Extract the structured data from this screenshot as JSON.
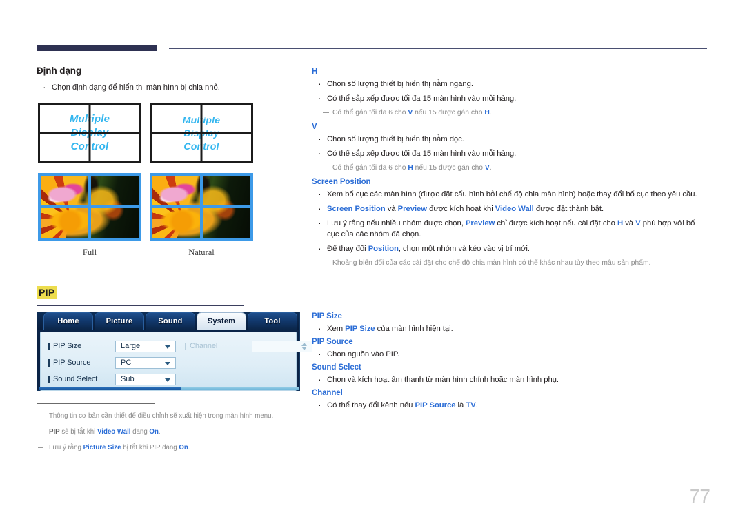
{
  "page": {
    "number": "77"
  },
  "left": {
    "section_title": "Định dạng",
    "bullet": "Chọn định dạng để hiển thị màn hình bị chia nhỏ.",
    "diagram": {
      "panel_a": {
        "text_lines": [
          "Multiple",
          "Display",
          "Control"
        ],
        "caption": "Full"
      },
      "panel_b": {
        "text_lines": [
          "Multiple",
          "Display",
          "Control"
        ],
        "caption": "Natural"
      }
    },
    "pip": {
      "label": "PIP"
    },
    "osd": {
      "tabs": [
        {
          "label": "Home",
          "active": false
        },
        {
          "label": "Picture",
          "active": false
        },
        {
          "label": "Sound",
          "active": false
        },
        {
          "label": "System",
          "active": true
        },
        {
          "label": "Tool",
          "active": false
        }
      ],
      "rows": [
        {
          "key": "PIP Size",
          "value": "Large"
        },
        {
          "key": "PIP Source",
          "value": "PC"
        },
        {
          "key": "Sound Select",
          "value": "Sub"
        }
      ],
      "channel": {
        "key": "Channel",
        "value": ""
      }
    },
    "footnotes": [
      {
        "parts": [
          {
            "t": "Thông tin cơ bản cần thiết để điều chỉnh sẽ xuất hiện trong màn hình menu.",
            "s": "plain"
          }
        ]
      },
      {
        "parts": [
          {
            "t": "PIP",
            "s": "dark"
          },
          {
            "t": " sẽ bị tắt khi ",
            "s": "plain"
          },
          {
            "t": "Video Wall",
            "s": "blue"
          },
          {
            "t": " đang ",
            "s": "plain"
          },
          {
            "t": "On",
            "s": "blue"
          },
          {
            "t": ".",
            "s": "plain"
          }
        ]
      },
      {
        "parts": [
          {
            "t": "Lưu ý rằng ",
            "s": "plain"
          },
          {
            "t": "Picture Size",
            "s": "blue"
          },
          {
            "t": " bị tắt khi PIP đang ",
            "s": "plain"
          },
          {
            "t": "On",
            "s": "blue"
          },
          {
            "t": ".",
            "s": "plain"
          }
        ]
      }
    ]
  },
  "right": {
    "blocks": [
      {
        "type": "head",
        "text": "H"
      },
      {
        "type": "bullet",
        "parts": [
          {
            "t": "Chọn số lượng thiết bị hiển thị nằm ngang.",
            "s": "plain"
          }
        ]
      },
      {
        "type": "bullet",
        "parts": [
          {
            "t": "Có thể sắp xếp được tối đa 15 màn hình vào mỗi hàng.",
            "s": "plain"
          }
        ]
      },
      {
        "type": "note",
        "parts": [
          {
            "t": "Có thể gán tối đa 6 cho ",
            "s": "plain"
          },
          {
            "t": "V",
            "s": "blue"
          },
          {
            "t": " nếu 15 được gán cho ",
            "s": "plain"
          },
          {
            "t": "H",
            "s": "blue"
          },
          {
            "t": ".",
            "s": "plain"
          }
        ]
      },
      {
        "type": "head",
        "text": "V"
      },
      {
        "type": "bullet",
        "parts": [
          {
            "t": "Chọn số lượng thiết bị hiển thị nằm dọc.",
            "s": "plain"
          }
        ]
      },
      {
        "type": "bullet",
        "parts": [
          {
            "t": "Có thể sắp xếp được tối đa 15 màn hình vào mỗi hàng.",
            "s": "plain"
          }
        ]
      },
      {
        "type": "note",
        "parts": [
          {
            "t": "Có thể gán tối đa 6 cho ",
            "s": "plain"
          },
          {
            "t": "H",
            "s": "blue"
          },
          {
            "t": " nếu 15 được gán cho ",
            "s": "plain"
          },
          {
            "t": "V",
            "s": "blue"
          },
          {
            "t": ".",
            "s": "plain"
          }
        ]
      },
      {
        "type": "head",
        "text": "Screen Position"
      },
      {
        "type": "bullet",
        "parts": [
          {
            "t": "Xem bố cục các màn hình (được đặt cấu hình bởi chế độ chia màn hình) hoặc thay đổi bố cục theo yêu cầu.",
            "s": "plain"
          }
        ]
      },
      {
        "type": "bullet",
        "parts": [
          {
            "t": "Screen Position",
            "s": "blue"
          },
          {
            "t": " và ",
            "s": "plain"
          },
          {
            "t": "Preview",
            "s": "blue"
          },
          {
            "t": " được kích hoạt khi ",
            "s": "plain"
          },
          {
            "t": "Video Wall",
            "s": "blue"
          },
          {
            "t": " được đặt thành bật.",
            "s": "plain"
          }
        ]
      },
      {
        "type": "bullet",
        "parts": [
          {
            "t": "Lưu ý rằng nếu nhiều nhóm được chọn, ",
            "s": "plain"
          },
          {
            "t": "Preview",
            "s": "blue"
          },
          {
            "t": " chỉ được kích hoạt nếu cài đặt cho ",
            "s": "plain"
          },
          {
            "t": "H",
            "s": "blue"
          },
          {
            "t": " và ",
            "s": "plain"
          },
          {
            "t": "V",
            "s": "blue"
          },
          {
            "t": " phù hợp với bố cục của các nhóm đã chọn.",
            "s": "plain"
          }
        ]
      },
      {
        "type": "bullet",
        "parts": [
          {
            "t": "Để thay đổi ",
            "s": "plain"
          },
          {
            "t": "Position",
            "s": "blue"
          },
          {
            "t": ", chọn một nhóm và kéo vào vị trí mới.",
            "s": "plain"
          }
        ]
      },
      {
        "type": "note",
        "parts": [
          {
            "t": "Khoảng biến đổi của các cài đặt cho chế độ chia màn hình có thể khác nhau tùy theo mẫu sản phẩm.",
            "s": "plain"
          }
        ]
      }
    ],
    "pip_blocks": [
      {
        "type": "head",
        "text": "PIP Size"
      },
      {
        "type": "bullet",
        "parts": [
          {
            "t": "Xem ",
            "s": "plain"
          },
          {
            "t": "PIP Size",
            "s": "blue"
          },
          {
            "t": " của màn hình hiện tại.",
            "s": "plain"
          }
        ]
      },
      {
        "type": "head",
        "text": "PIP Source"
      },
      {
        "type": "bullet",
        "parts": [
          {
            "t": "Chọn nguồn vào PIP.",
            "s": "plain"
          }
        ]
      },
      {
        "type": "head",
        "text": "Sound Select"
      },
      {
        "type": "bullet",
        "parts": [
          {
            "t": "Chọn và kích hoạt âm thanh từ màn hình chính hoặc màn hình phụ.",
            "s": "plain"
          }
        ]
      },
      {
        "type": "head",
        "text": "Channel"
      },
      {
        "type": "bullet",
        "parts": [
          {
            "t": "Có thể thay đổi kênh nếu ",
            "s": "plain"
          },
          {
            "t": "PIP Source",
            "s": "blue"
          },
          {
            "t": " là ",
            "s": "plain"
          },
          {
            "t": "TV",
            "s": "blue"
          },
          {
            "t": ".",
            "s": "plain"
          }
        ]
      }
    ]
  },
  "colors": {
    "accent_blue": "#2b6dd6",
    "header_navy": "#2e3152",
    "highlight_yellow": "#eddd4e",
    "screen_border_blue": "#3d9ae8",
    "logo_cyan": "#33b6ef"
  }
}
